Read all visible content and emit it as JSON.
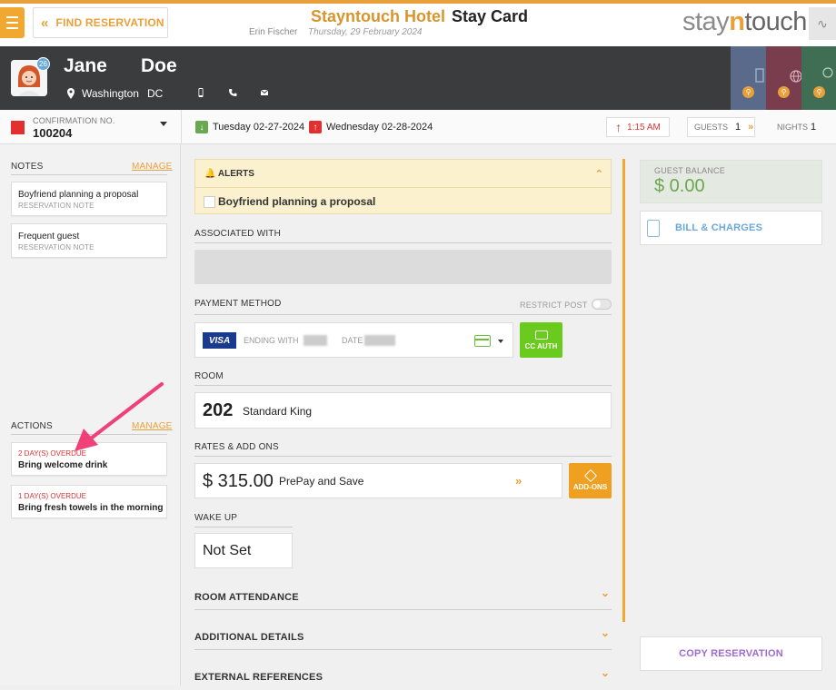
{
  "header": {
    "find_label": "FIND RESERVATION",
    "hotel_name": "Stayntouch Hotel",
    "page_title": "Stay Card",
    "user": "Erin Fischer",
    "date": "Thursday, 29 February 2024",
    "logo_a": "stay",
    "logo_n": "n",
    "logo_b": "touch"
  },
  "guest": {
    "first_name": "Jane",
    "last_name": "Doe",
    "badge": "26",
    "city": "Washington",
    "state": "DC"
  },
  "reservation": {
    "confirmation_label": "CONFIRMATION NO.",
    "confirmation_no": "100204",
    "arrival": "Tuesday 02-27-2024",
    "departure": "Wednesday 02-28-2024",
    "time": "1:15 AM",
    "guests_label": "GUESTS",
    "guests": "1",
    "nights_label": "NIGHTS",
    "nights": "1"
  },
  "notes": {
    "header": "NOTES",
    "manage": "MANAGE",
    "items": [
      {
        "title": "Boyfriend planning a proposal",
        "sub": "RESERVATION NOTE"
      },
      {
        "title": "Frequent guest",
        "sub": "RESERVATION NOTE"
      }
    ]
  },
  "actions": {
    "header": "ACTIONS",
    "manage": "MANAGE",
    "items": [
      {
        "overdue": "2 DAY(S) OVERDUE",
        "title": "Bring welcome drink"
      },
      {
        "overdue": "1 DAY(S) OVERDUE",
        "title": "Bring fresh towels in the morning"
      }
    ]
  },
  "main": {
    "alerts_header": "ALERTS",
    "alert_text": "Boyfriend planning a proposal",
    "associated_label": "ASSOCIATED WITH",
    "payment_label": "PAYMENT METHOD",
    "restrict_post": "RESTRICT POST",
    "card_brand": "VISA",
    "ending_label": "ENDING WITH",
    "date_label": "DATE",
    "cc_auth": "CC AUTH",
    "room_label": "ROOM",
    "room_number": "202",
    "room_type": "Standard King",
    "rates_label": "RATES & ADD ONS",
    "rate_amount": "$ 315.00",
    "rate_name": "PrePay and Save",
    "addons": "ADD-ONS",
    "wakeup_label": "WAKE UP",
    "wakeup_value": "Not Set",
    "room_attendance": "ROOM ATTENDANCE",
    "additional_details": "ADDITIONAL DETAILS",
    "external_references": "EXTERNAL REFERENCES"
  },
  "right": {
    "balance_label": "GUEST BALANCE",
    "balance_value": "$ 0.00",
    "bill_label": "BILL & CHARGES",
    "copy_label": "COPY RESERVATION"
  },
  "colors": {
    "accent": "#e8a03a",
    "alert_bg": "#fbf1cf",
    "success": "#6acb1e",
    "danger": "#e23030"
  }
}
